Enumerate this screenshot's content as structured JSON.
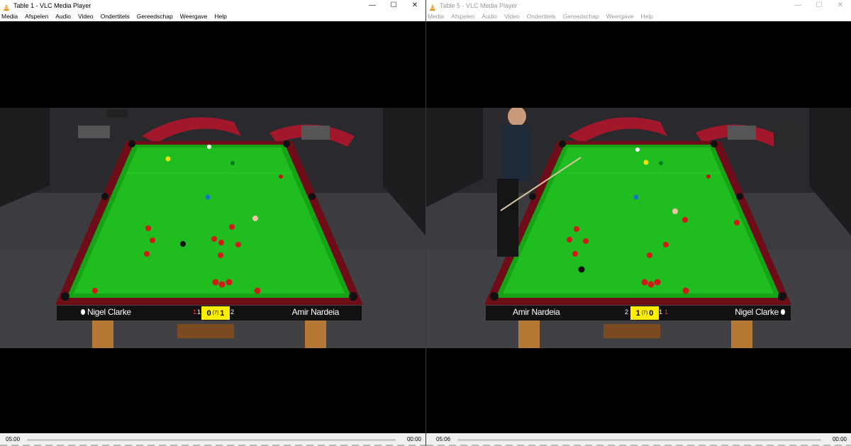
{
  "left_window": {
    "title": "Table 1 - VLC Media Player",
    "active": true,
    "menu": [
      "Media",
      "Afspelen",
      "Audio",
      "Video",
      "Ondertitels",
      "Gereedschap",
      "Weergave",
      "Help"
    ],
    "scoreboard": {
      "player_left": "Nigel Clarke",
      "player_right": "Amir Nardeia",
      "frames_left": "0",
      "best_of": "(7)",
      "frames_right": "1",
      "break_left": "1",
      "break_left_small": "1",
      "break_right": "2",
      "turn": "left"
    },
    "time_elapsed": "05:00",
    "time_total": "00:00"
  },
  "right_window": {
    "title": "Table 5 - VLC Media Player",
    "active": false,
    "menu": [
      "Media",
      "Afspelen",
      "Audio",
      "Video",
      "Ondertitels",
      "Gereedschap",
      "Weergave",
      "Help"
    ],
    "scoreboard": {
      "player_left": "Amir Nardeia",
      "player_right": "Nigel Clarke",
      "frames_left": "1",
      "best_of": "(7)",
      "frames_right": "0",
      "break_left": "2",
      "break_right": "1",
      "break_right_small": "1",
      "turn": "right"
    },
    "time_elapsed": "05:06",
    "time_total": "00:00"
  },
  "window_controls": {
    "minimize": "—",
    "maximize": "☐",
    "close": "✕"
  },
  "colors": {
    "cloth": "#1fbd1f",
    "rail": "#7a0f1c",
    "vlc_orange": "#f28c00",
    "frames_box": "#ffee00"
  }
}
